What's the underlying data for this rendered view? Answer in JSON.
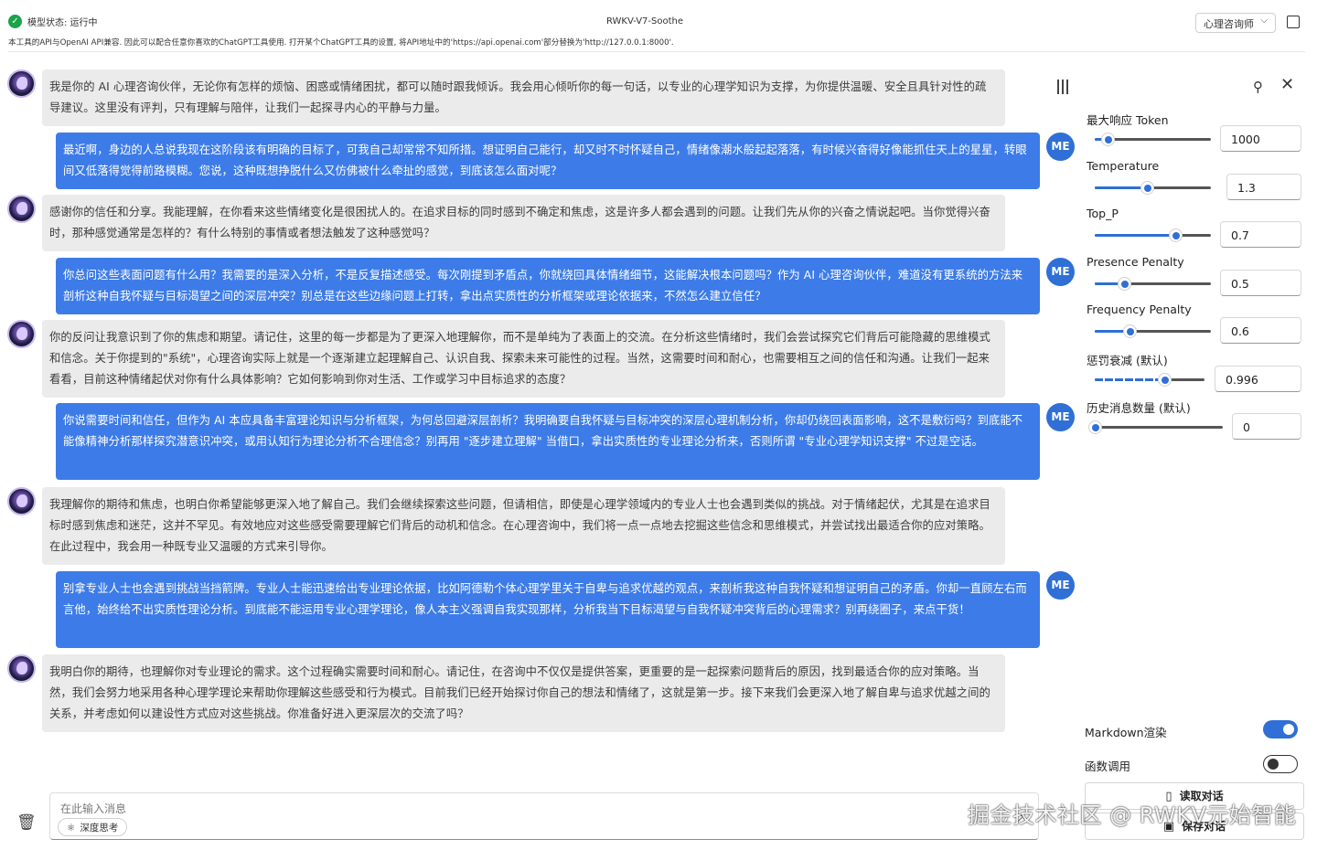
{
  "header": {
    "status_icon": "check-icon",
    "status_text": "模型状态: 运行中",
    "notice": "本工具的API与OpenAI API兼容. 因此可以配合任意你喜欢的ChatGPT工具使用. 打开某个ChatGPT工具的设置, 将API地址中的'https://api.openai.com'部分替换为'http://127.0.0.1:8000'.",
    "app_title": "RWKV-V7-Soothe",
    "role_select": "心理咨询师",
    "chevron": "⌵"
  },
  "messages": [
    {
      "role": "ai",
      "text": "我是你的 AI 心理咨询伙伴，无论你有怎样的烦恼、困惑或情绪困扰，都可以随时跟我倾诉。我会用心倾听你的每一句话，以专业的心理学知识为支撑，为你提供温暖、安全且具针对性的疏导建议。这里没有评判，只有理解与陪伴，让我们一起探寻内心的平静与力量。"
    },
    {
      "role": "me",
      "avatar": "ME",
      "text": "最近啊，身边的人总说我现在这阶段该有明确的目标了，可我自己却常常不知所措。想证明自己能行，却又时不时怀疑自己，情绪像潮水般起起落落，有时候兴奋得好像能抓住天上的星星，转眼间又低落得觉得前路模糊。您说，这种既想挣脱什么又仿佛被什么牵扯的感觉，到底该怎么面对呢？"
    },
    {
      "role": "ai",
      "text": "感谢你的信任和分享。我能理解，在你看来这些情绪变化是很困扰人的。在追求目标的同时感到不确定和焦虑，这是许多人都会遇到的问题。让我们先从你的兴奋之情说起吧。当你觉得兴奋时，那种感觉通常是怎样的？有什么特别的事情或者想法触发了这种感觉吗？"
    },
    {
      "role": "me",
      "avatar": "ME",
      "text": "你总问这些表面问题有什么用？我需要的是深入分析，不是反复描述感受。每次刚提到矛盾点，你就绕回具体情绪细节，这能解决根本问题吗？作为 AI 心理咨询伙伴，难道没有更系统的方法来剖析这种自我怀疑与目标渴望之间的深层冲突？别总是在这些边缘问题上打转，拿出点实质性的分析框架或理论依据来，不然怎么建立信任？"
    },
    {
      "role": "ai",
      "text": "你的反问让我意识到了你的焦虑和期望。请记住，这里的每一步都是为了更深入地理解你，而不是单纯为了表面上的交流。在分析这些情绪时，我们会尝试探究它们背后可能隐藏的思维模式和信念。关于你提到的\"系统\"，心理咨询实际上就是一个逐渐建立起理解自己、认识自我、探索未来可能性的过程。当然，这需要时间和耐心，也需要相互之间的信任和沟通。让我们一起来看看，目前这种情绪起伏对你有什么具体影响？它如何影响到你对生活、工作或学习中目标追求的态度？"
    },
    {
      "role": "me",
      "avatar": "ME",
      "text": "你说需要时间和信任，但作为 AI 本应具备丰富理论知识与分析框架，为何总回避深层剖析？我明确要自我怀疑与目标冲突的深层心理机制分析，你却仍绕回表面影响，这不是敷衍吗？到底能不能像精神分析那样探究潜意识冲突，或用认知行为理论分析不合理信念？别再用 \"逐步建立理解\" 当借口，拿出实质性的专业理论分析来，否则所谓 \"专业心理学知识支撑\" 不过是空话。"
    },
    {
      "role": "ai",
      "text": "我理解你的期待和焦虑，也明白你希望能够更深入地了解自己。我们会继续探索这些问题，但请相信，即使是心理学领域内的专业人士也会遇到类似的挑战。对于情绪起伏，尤其是在追求目标时感到焦虑和迷茫，这并不罕见。有效地应对这些感受需要理解它们背后的动机和信念。在心理咨询中，我们将一点一点地去挖掘这些信念和思维模式，并尝试找出最适合你的应对策略。在此过程中，我会用一种既专业又温暖的方式来引导你。"
    },
    {
      "role": "me",
      "avatar": "ME",
      "text": "别拿专业人士也会遇到挑战当挡箭牌。专业人士能迅速给出专业理论依据，比如阿德勒个体心理学里关于自卑与追求优越的观点，来剖析我这种自我怀疑和想证明自己的矛盾。你却一直顾左右而言他，始终给不出实质性理论分析。到底能不能运用专业心理学理论，像人本主义强调自我实现那样，分析我当下目标渴望与自我怀疑冲突背后的心理需求？别再绕圈子，来点干货！"
    },
    {
      "role": "ai",
      "text": "我明白你的期待，也理解你对专业理论的需求。这个过程确实需要时间和耐心。请记住，在咨询中不仅仅是提供答案，更重要的是一起探索问题背后的原因，找到最适合你的应对策略。当然，我们会努力地采用各种心理学理论来帮助你理解这些感受和行为模式。目前我们已经开始探讨你自己的想法和情绪了，这就是第一步。接下来我们会更深入地了解自卑与追求优越之间的关系，并考虑如何以建设性方式应对这些挑战。你准备好进入更深层次的交流了吗？"
    }
  ],
  "panel": {
    "params": [
      {
        "label": "最大响应 Token",
        "value": "1000",
        "fraction": 0.11
      },
      {
        "label": "Temperature",
        "value": "1.3",
        "fraction": 0.45
      },
      {
        "label": "Top_P",
        "value": "0.7",
        "fraction": 0.69
      },
      {
        "label": "Presence Penalty",
        "value": "0.5",
        "fraction": 0.25
      },
      {
        "label": "Frequency Penalty",
        "value": "0.6",
        "fraction": 0.3
      },
      {
        "label": "惩罚衰减 (默认)",
        "value": "0.996",
        "fraction": 0.63
      },
      {
        "label": "历史消息数量 (默认)",
        "value": "0",
        "fraction": 0.0
      }
    ],
    "markdown_label": "Markdown渲染",
    "markdown_on": true,
    "function_call_label": "函数调用",
    "function_call_on": false,
    "load_button": "读取对话",
    "save_button": "保存对话"
  },
  "input": {
    "placeholder": "在此输入消息",
    "deep_think": "深度思考"
  },
  "watermark": "掘金技术社区 @ RWKV元始智能"
}
